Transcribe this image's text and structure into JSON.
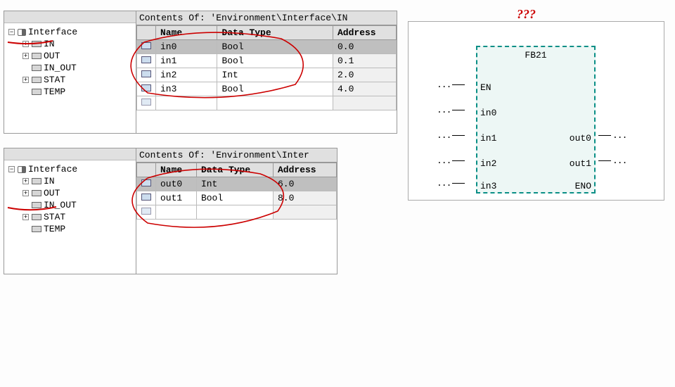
{
  "panel_in": {
    "tree": {
      "root": "Interface",
      "items": [
        "IN",
        "OUT",
        "IN_OUT",
        "STAT",
        "TEMP"
      ],
      "selected": "IN"
    },
    "contents_label": "Contents Of: 'Environment\\Interface\\IN",
    "columns": {
      "name": "Name",
      "type": "Data Type",
      "addr": "Address"
    },
    "rows": [
      {
        "name": "in0",
        "type": "Bool",
        "addr": "0.0",
        "sel": true
      },
      {
        "name": "in1",
        "type": "Bool",
        "addr": "0.1"
      },
      {
        "name": "in2",
        "type": "Int",
        "addr": "2.0"
      },
      {
        "name": "in3",
        "type": "Bool",
        "addr": "4.0"
      }
    ]
  },
  "panel_out": {
    "tree": {
      "root": "Interface",
      "items": [
        "IN",
        "OUT",
        "IN_OUT",
        "STAT",
        "TEMP"
      ],
      "selected": "OUT"
    },
    "contents_label": "Contents Of: 'Environment\\Inter",
    "columns": {
      "name": "Name",
      "type": "Data Type",
      "addr": "Address"
    },
    "rows": [
      {
        "name": "out0",
        "type": "Int",
        "addr": "6.0",
        "sel": true
      },
      {
        "name": "out1",
        "type": "Bool",
        "addr": "8.0"
      }
    ]
  },
  "fb": {
    "annotation": "???",
    "title": "FB21",
    "left_ports": [
      "EN",
      "in0",
      "in1",
      "in2",
      "in3"
    ],
    "right_ports": [
      "",
      "",
      "out0",
      "out1",
      "ENO"
    ],
    "conn_dots": "..."
  },
  "glyphs": {
    "plus": "+",
    "minus": "−"
  }
}
